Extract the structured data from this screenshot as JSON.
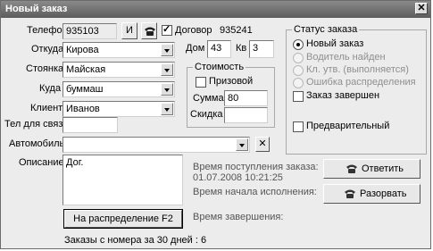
{
  "window": {
    "title": "Новый заказ"
  },
  "phone": {
    "label": "Телефон",
    "value": "935103",
    "btn_i": "И"
  },
  "contract": {
    "label": "Договор",
    "number": "935241",
    "checked": true
  },
  "from": {
    "label": "Откуда",
    "value": "Кирова"
  },
  "house": {
    "label": "Дом",
    "value": "43"
  },
  "apt": {
    "label": "Кв",
    "value": "3"
  },
  "stand": {
    "label": "Стоянка",
    "value": "Майская"
  },
  "to": {
    "label": "Куда",
    "value": "буммаш"
  },
  "client": {
    "label": "Клиент",
    "value": "Иванов"
  },
  "contact": {
    "label": "Тел для связи",
    "value": ""
  },
  "car": {
    "label": "Автомобиль",
    "value": ""
  },
  "description": {
    "label": "Описание",
    "value": "Дог."
  },
  "cost": {
    "caption": "Стоимость",
    "prize_label": "Призовой",
    "sum_label": "Сумма",
    "sum_value": "80",
    "discount_label": "Скидка",
    "discount_value": ""
  },
  "status": {
    "caption": "Статус заказа",
    "options": [
      "Новый заказ",
      "Водитель найден",
      "Кл. утв. (выполняется)",
      "Ошибка распределения"
    ],
    "selected": "Новый заказ",
    "completed_label": "Заказ завершен",
    "preliminary_label": "Предварительный"
  },
  "times": {
    "received_label": "Время поступления заказа:",
    "received_value": "01.07.2008 10:21:25",
    "start_label": "Время начала исполнения:",
    "end_label": "Время завершения:"
  },
  "buttons": {
    "answer": "Ответить",
    "disconnect": "Разорвать",
    "distribute": "На распределение F2"
  },
  "footer": {
    "orders": "Заказы с номера за 30 дней : 6"
  },
  "colors": {
    "titlebar": "#6e6e6e",
    "window_bg": "#ececec"
  }
}
